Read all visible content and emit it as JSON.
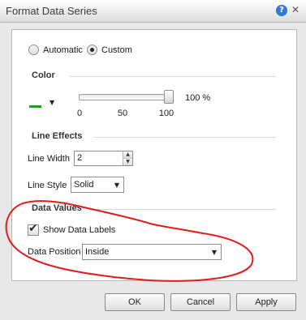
{
  "dialog": {
    "title": "Format Data Series",
    "help_label": "?",
    "close_label": "✕"
  },
  "color_mode": {
    "automatic_label": "Automatic",
    "custom_label": "Custom",
    "selected": "Custom"
  },
  "color": {
    "section_title": "Color",
    "swatch_color": "#1aa21a",
    "opacity_value": "100 %",
    "opacity_fraction": 1.0,
    "slider_ticks": [
      "0",
      "50",
      "100"
    ]
  },
  "line_effects": {
    "section_title": "Line Effects",
    "line_width_label": "Line Width",
    "line_width_value": "2",
    "line_style_label": "Line Style",
    "line_style_value": "Solid"
  },
  "data_values": {
    "section_title": "Data Values",
    "show_labels_label": "Show Data Labels",
    "show_labels_checked": true,
    "position_label": "Data Position",
    "position_value": "Inside"
  },
  "footer": {
    "ok_label": "OK",
    "cancel_label": "Cancel",
    "apply_label": "Apply"
  },
  "annotation_color": "#e01c1c"
}
